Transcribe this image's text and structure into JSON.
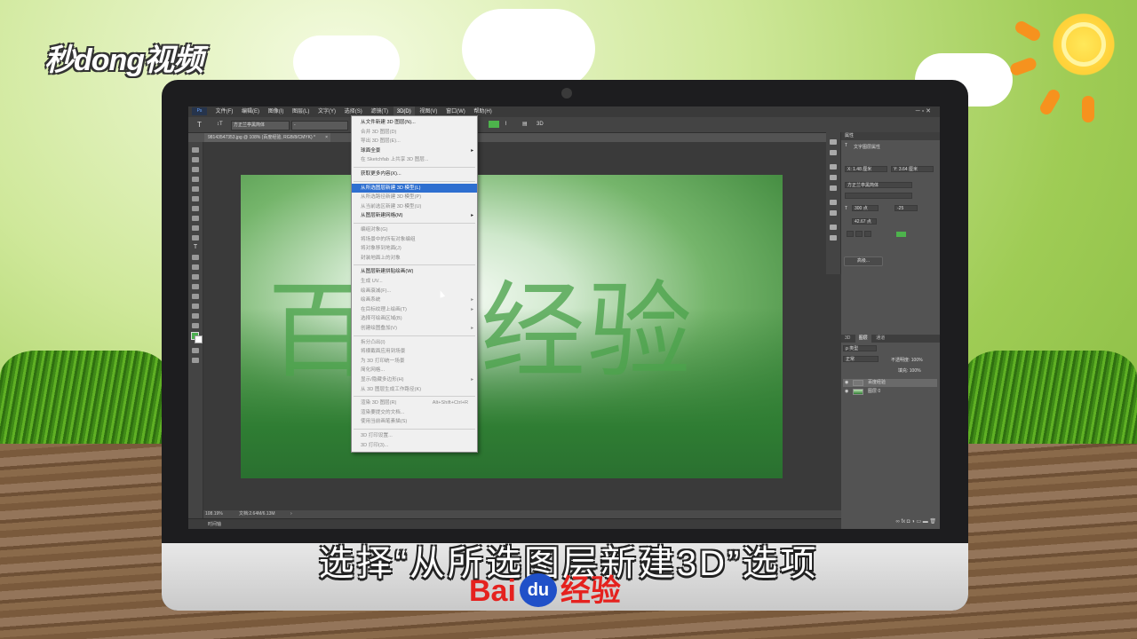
{
  "watermark": {
    "logo": "秒dong视频"
  },
  "subtitle": "选择“从所选图层新建3D”选项",
  "baidu": {
    "left": "Bai",
    "paw": "du",
    "right": "经验"
  },
  "ps": {
    "menubar": {
      "ps_logo": "Ps",
      "items": [
        "文件(F)",
        "编辑(E)",
        "图像(I)",
        "图层(L)",
        "文字(Y)",
        "选择(S)",
        "滤镜(T)",
        "3D(D)",
        "视图(V)",
        "窗口(W)",
        "帮助(H)"
      ],
      "active_item": "3D(D)",
      "window_controls": "─  ▫  ✕"
    },
    "options_bar": {
      "tool_icon": "T",
      "font_family": "方正兰亭黑简体",
      "font_style": "-",
      "mode_3d": "3D"
    },
    "document_tab": {
      "title": "98143547353.jpg @ 108% (百度经验, RGB/8/CMYK) *",
      "close": "×"
    },
    "canvas_text": "百度经验",
    "status": {
      "zoom": "108.19%",
      "doc_size": "文档:2.64M/6.13M"
    },
    "timeline_label": "时间轴",
    "properties_panel": {
      "title": "属性",
      "subtitle": "文字图层属性",
      "field_x": "X: 1.48 厘米",
      "field_y": "Y: 3.64 厘米",
      "font": "方正兰亭黑简体",
      "size": "300 点",
      "tracking": "-25",
      "leading": "42.67 点",
      "button": "高级..."
    },
    "layers_panel": {
      "tabs": [
        "3D",
        "图层",
        "通道"
      ],
      "selected_tab": "图层",
      "kind_filter": "ρ 类型",
      "blend_mode": "正常",
      "opacity": "不透明度: 100%",
      "fill": "填充: 100%",
      "layers": [
        {
          "name": "百度经验",
          "selected": true
        },
        {
          "name": "图层 0",
          "selected": false
        }
      ],
      "footer_icons": "∞ fx ◘ ◑ ▭ ▬ 🗑"
    },
    "menu_3d": {
      "items": [
        {
          "label": "从文件新建 3D 图层(N)...",
          "disabled": false
        },
        {
          "label": "合并 3D 图层(D)",
          "disabled": true
        },
        {
          "label": "导出 3D 图层(E)...",
          "disabled": true
        },
        {
          "label": "球面全景",
          "disabled": false,
          "submenu": true
        },
        {
          "label": "在 Sketchfab 上共享 3D 图层...",
          "disabled": true
        },
        {
          "sep": true
        },
        {
          "label": "获取更多内容(X)...",
          "disabled": false
        },
        {
          "sep": true
        },
        {
          "label": "从所选图层新建 3D 模型(L)",
          "disabled": false,
          "highlighted": true
        },
        {
          "label": "从所选路径新建 3D 模型(P)",
          "disabled": true
        },
        {
          "label": "从当前选区新建 3D 模型(U)",
          "disabled": true
        },
        {
          "label": "从图层新建网格(M)",
          "disabled": false,
          "submenu": true
        },
        {
          "sep": true
        },
        {
          "label": "编组对象(G)",
          "disabled": true
        },
        {
          "label": "将场景中的所有对象编组",
          "disabled": true
        },
        {
          "label": "将对象移到地面(J)",
          "disabled": true
        },
        {
          "label": "封装地面上的对象",
          "disabled": true
        },
        {
          "sep": true
        },
        {
          "label": "从图层新建拼贴绘画(W)",
          "disabled": false
        },
        {
          "label": "生成 UV...",
          "disabled": true
        },
        {
          "label": "绘画衰减(F)...",
          "disabled": true
        },
        {
          "label": "绘画系统",
          "disabled": true,
          "submenu": true
        },
        {
          "label": "在目标纹理上绘画(T)",
          "disabled": true,
          "submenu": true
        },
        {
          "label": "选择可绘画区域(B)",
          "disabled": true
        },
        {
          "label": "创建绘图叠加(V)",
          "disabled": true,
          "submenu": true
        },
        {
          "sep": true
        },
        {
          "label": "拆分凸出(I)",
          "disabled": true
        },
        {
          "label": "将横截面应用到场景",
          "disabled": true
        },
        {
          "label": "为 3D 打印统一场景",
          "disabled": true
        },
        {
          "label": "简化网格...",
          "disabled": true
        },
        {
          "label": "显示/隐藏多边形(H)",
          "disabled": true,
          "submenu": true
        },
        {
          "label": "从 3D 图层生成工作路径(K)",
          "disabled": true
        },
        {
          "sep": true
        },
        {
          "label": "渲染 3D 图层(R)",
          "disabled": true,
          "shortcut": "Alt+Shift+Ctrl+R"
        },
        {
          "label": "渲染要提交的文档...",
          "disabled": true
        },
        {
          "label": "使用当前画笔素描(S)",
          "disabled": true
        },
        {
          "sep": true
        },
        {
          "label": "3D 打印设置...",
          "disabled": true
        },
        {
          "label": "3D 打印(3)...",
          "disabled": true
        }
      ]
    }
  },
  "colors": {
    "accent": "#2e6fd0",
    "baidu_red": "#e5211e",
    "baidu_blue": "#2050c8",
    "text_green": "#4db34c"
  }
}
